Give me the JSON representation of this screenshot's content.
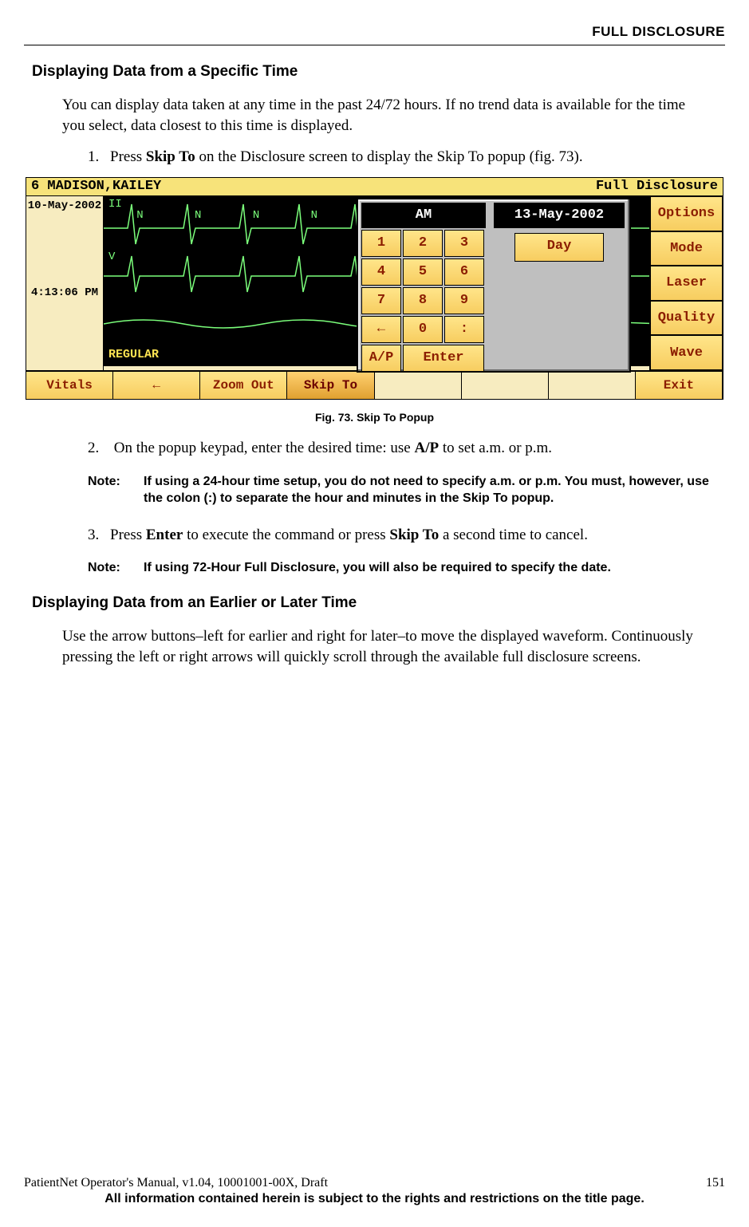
{
  "header": {
    "title": "FULL DISCLOSURE"
  },
  "section1": {
    "heading": "Displaying Data from a Specific Time",
    "intro": "You can display data taken at any time in the past 24/72 hours. If no trend data is available for the time you select, data closest to this time is displayed.",
    "step1_num": "1.",
    "step1_a": "Press ",
    "step1_b": "Skip To",
    "step1_c": " on the Disclosure screen to display the Skip To popup (fig. 73)."
  },
  "figure": {
    "titlebar_left": "6  MADISON,KAILEY",
    "titlebar_right": "Full Disclosure",
    "date": "10-May-2002",
    "time": "4:13:06 PM",
    "lead_ii": "II",
    "lead_v": "V",
    "beat_labels": "   N      N      N      N",
    "regular": "REGULAR",
    "right_buttons": [
      "Options",
      "Mode",
      "Laser",
      "Quality",
      "Wave"
    ],
    "bottom_buttons": [
      "Vitals",
      "←",
      "Zoom Out",
      "Skip To",
      "",
      "",
      "",
      "Exit"
    ],
    "popup": {
      "header": "AM",
      "keys": [
        "1",
        "2",
        "3",
        "4",
        "5",
        "6",
        "7",
        "8",
        "9",
        "←",
        "0",
        ":",
        "A/P",
        "Enter"
      ],
      "date_display": "13-May-2002",
      "day_button": "Day"
    },
    "caption": "Fig. 73. Skip To Popup"
  },
  "section1b": {
    "step2_num": "2.",
    "step2_a": " On the popup keypad, enter the desired time: use ",
    "step2_b": "A/P",
    "step2_c": " to set a.m. or p.m.",
    "note1_label": "Note:",
    "note1_text": "If using a 24-hour time setup,  you do not need to specify a.m. or p.m. You must, however, use the colon (:) to separate the hour and minutes in the Skip To popup.",
    "step3_num": "3.",
    "step3_a": "Press ",
    "step3_b": "Enter",
    "step3_c": " to execute the command or press ",
    "step3_d": "Skip To",
    "step3_e": " a second time to cancel.",
    "note2_label": "Note:",
    "note2_text": "If using 72-Hour Full Disclosure, you will also be required to specify the date."
  },
  "section2": {
    "heading": "Displaying Data from an Earlier or Later Time",
    "body": "Use the arrow buttons–left for earlier and right for later–to move the displayed waveform. Continuously pressing the left or right arrows will quickly scroll through the available full disclosure screens."
  },
  "footer": {
    "left": "PatientNet Operator's Manual, v1.04, 10001001-00X, Draft",
    "right": "151",
    "line2": "All information contained herein is subject to the rights and restrictions on the title page."
  }
}
